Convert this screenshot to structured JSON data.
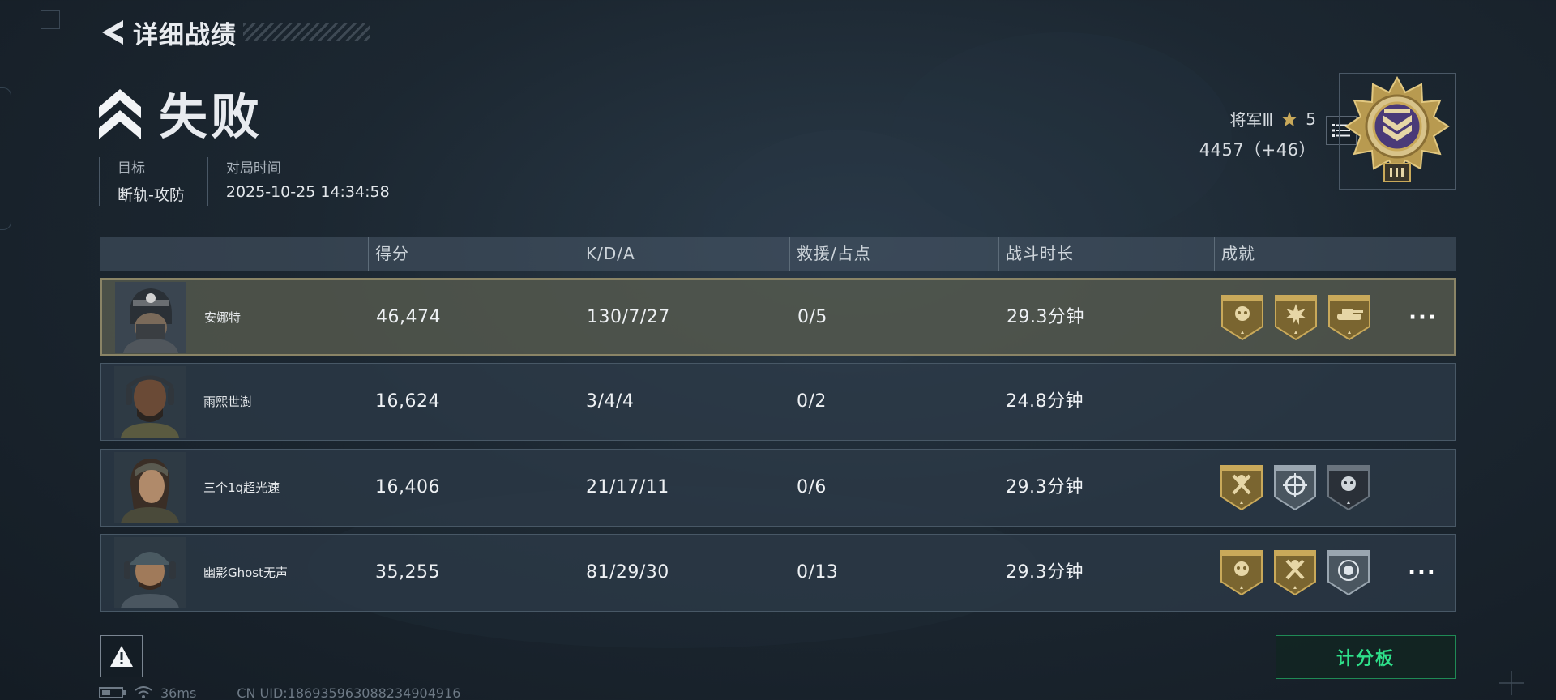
{
  "header": {
    "back_icon": "back-arrow-icon",
    "title": "详细战绩"
  },
  "result": {
    "icon": "double-chevron-up-icon",
    "title": "失败"
  },
  "meta": {
    "objective_label": "目标",
    "objective_value": "断轨-攻防",
    "time_label": "对局时间",
    "time_value": "2025-10-25 14:34:58"
  },
  "rank": {
    "name": "将军Ⅲ",
    "star_icon": "star-icon",
    "stars": "5",
    "points": "4457（+46）",
    "list_icon": "list-icon",
    "medal_icon": "general-rank-medal-icon"
  },
  "table": {
    "headers": [
      "得分",
      "K/D/A",
      "救援/占点",
      "战斗时长",
      "成就"
    ],
    "rows": [
      {
        "name": "安娜特",
        "score": "46,474",
        "kda": "130/7/27",
        "rescue": "0/5",
        "duration": "29.3分钟",
        "badges": [
          "gold-skull-badge-icon",
          "gold-burst-badge-icon",
          "gold-tank-badge-icon"
        ],
        "has_more": true
      },
      {
        "name": "雨熙世澍",
        "score": "16,624",
        "kda": "3/4/4",
        "rescue": "0/2",
        "duration": "24.8分钟",
        "badges": [],
        "has_more": false
      },
      {
        "name": "三个1q超光速",
        "score": "16,406",
        "kda": "21/17/11",
        "rescue": "0/6",
        "duration": "29.3分钟",
        "badges": [
          "gold-axes-badge-icon",
          "silver-target-badge-icon",
          "dark-skull-badge-icon"
        ],
        "has_more": false
      },
      {
        "name": "幽影Ghost无声",
        "score": "35,255",
        "kda": "81/29/30",
        "rescue": "0/13",
        "duration": "29.3分钟",
        "badges": [
          "gold-skull-badge-icon",
          "gold-axes-badge-icon",
          "silver-skull-target-badge-icon"
        ],
        "has_more": true
      }
    ],
    "more_label": "···"
  },
  "footer": {
    "warn_icon": "warning-icon",
    "scoreboard_label": "计分板",
    "ping": "36ms",
    "uid": "CN UID:18693596308823490491​6"
  },
  "colors": {
    "accent_green": "#2ee08a",
    "gold": "#b79a52",
    "highlight_border": "#8a8466"
  }
}
